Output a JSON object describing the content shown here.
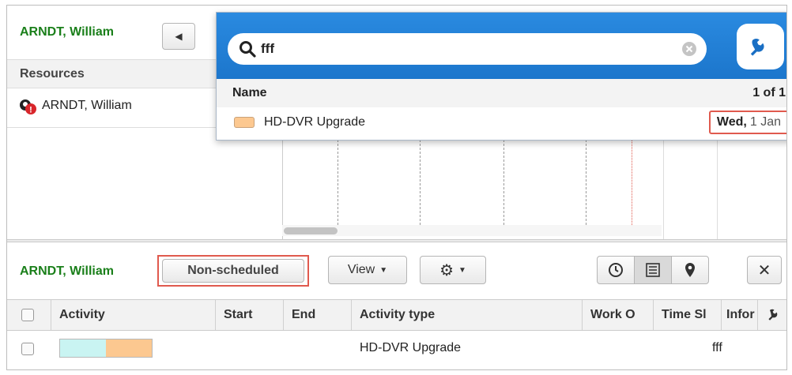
{
  "top": {
    "resource_name": "ARNDT, William"
  },
  "resources": {
    "header": "Resources",
    "items": [
      {
        "name": "ARNDT, William",
        "icon": "resource-alert-icon"
      }
    ]
  },
  "search": {
    "query": "fff",
    "col_name": "Name",
    "count": "1 of 1",
    "results": [
      {
        "name": "HD-DVR Upgrade",
        "day": "Wed,",
        "date": "1 Jan",
        "color": "#fcc890"
      }
    ]
  },
  "bottom": {
    "resource_name": "ARNDT, William",
    "filter_label": "Non-scheduled",
    "view_label": "View",
    "columns": [
      "Activity",
      "Start",
      "End",
      "Activity type",
      "Work O",
      "Time Sl",
      "Infor"
    ],
    "rows": [
      {
        "activity_type": "HD-DVR Upgrade",
        "info": "fff",
        "colors": [
          "#c9f4f2",
          "#fcc890"
        ]
      }
    ]
  },
  "colors": {
    "accent_green": "#1a7f1a",
    "highlight_red": "#e05a4e",
    "popup_blue": "#1f7fd4"
  }
}
